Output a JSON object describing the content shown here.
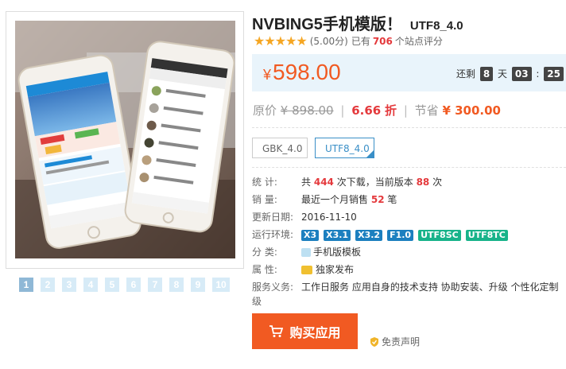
{
  "product": {
    "title": "NVBING5手机模版！",
    "title_tag": "UTF8_4.0",
    "stars": "★★★★★",
    "score": "(5.00分)",
    "sites_prefix": "已有",
    "sites_count": "706",
    "sites_suffix": "个站点评分"
  },
  "price": {
    "symbol": "¥",
    "value": "598.00",
    "countdown_prefix": "还剩",
    "days": "8",
    "days_label": "天",
    "hours": "03",
    "colon": ":",
    "minutes": "25"
  },
  "pricing": {
    "orig_label": "原价",
    "orig_value": "¥ 898.00",
    "sep": "|",
    "discount": "6.66",
    "discount_label": "折",
    "save_label": "节省",
    "save_value": "¥ 300.00"
  },
  "versions": [
    "GBK_4.0",
    "UTF8_4.0"
  ],
  "thumbs": [
    "1",
    "2",
    "3",
    "4",
    "5",
    "6",
    "7",
    "8",
    "9",
    "10"
  ],
  "details": {
    "stats": {
      "label": "统    计:",
      "pre": "共",
      "downloads": "444",
      "mid": "次下载，当前版本",
      "version_count": "88",
      "post": "次"
    },
    "sales": {
      "label": "销    量:",
      "pre": "最近一个月销售",
      "count": "52",
      "post": "笔"
    },
    "updated": {
      "label": "更新日期:",
      "value": "2016-11-10"
    },
    "env": {
      "label": "运行环境:",
      "tags": [
        "X3",
        "X3.1",
        "X3.2",
        "F1.0",
        "UTF8SC",
        "UTF8TC"
      ]
    },
    "category": {
      "label": "分    类:",
      "value": "手机版模板"
    },
    "attribute": {
      "label": "属    性:",
      "value": "独家发布"
    },
    "service": {
      "label": "服务义务:",
      "value": "工作日服务  应用自身的技术支持  协助安装、升级  个性化定制",
      "value2": "级"
    }
  },
  "actions": {
    "buy_label": "购买应用",
    "disclaimer": "免责声明"
  },
  "colors": {
    "accent": "#f15a22",
    "link": "#3a8fc7",
    "red": "#e4393c"
  }
}
